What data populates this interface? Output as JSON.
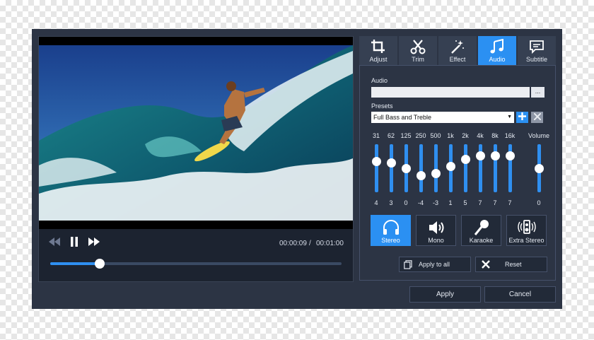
{
  "player": {
    "current_time": "00:00:09",
    "separator": "/",
    "total_time": "00:01:00",
    "progress_fraction": 0.171
  },
  "tabs": [
    {
      "label": "Adjust",
      "icon": "crop-icon",
      "active": false
    },
    {
      "label": "Trim",
      "icon": "scissors-icon",
      "active": false
    },
    {
      "label": "Effect",
      "icon": "magic-wand-icon",
      "active": false
    },
    {
      "label": "Audio",
      "icon": "music-note-icon",
      "active": true
    },
    {
      "label": "Subtitle",
      "icon": "subtitle-icon",
      "active": false
    }
  ],
  "audio": {
    "audio_label": "Audio",
    "audio_value": "",
    "browse_label": "...",
    "presets_label": "Presets",
    "preset_value": "Full Bass and Treble"
  },
  "equalizer": {
    "bands": [
      {
        "freq": "31",
        "gain": "4"
      },
      {
        "freq": "62",
        "gain": "3"
      },
      {
        "freq": "125",
        "gain": "0"
      },
      {
        "freq": "250",
        "gain": "-4"
      },
      {
        "freq": "500",
        "gain": "-3"
      },
      {
        "freq": "1k",
        "gain": "1"
      },
      {
        "freq": "2k",
        "gain": "5"
      },
      {
        "freq": "4k",
        "gain": "7"
      },
      {
        "freq": "8k",
        "gain": "7"
      },
      {
        "freq": "16k",
        "gain": "7"
      }
    ],
    "volume": {
      "label": "Volume",
      "value": "0"
    }
  },
  "modes": [
    {
      "label": "Stereo",
      "icon": "headphones-icon",
      "active": true
    },
    {
      "label": "Mono",
      "icon": "speaker-icon",
      "active": false
    },
    {
      "label": "Karaoke",
      "icon": "microphone-icon",
      "active": false
    },
    {
      "label": "Extra Stereo",
      "icon": "surround-speaker-icon",
      "active": false
    }
  ],
  "actions": {
    "apply_all": "Apply to all",
    "reset": "Reset",
    "apply": "Apply",
    "cancel": "Cancel"
  },
  "colors": {
    "accent": "#2b90f2",
    "window_bg": "#2c3444",
    "panel_bg": "#1e2531"
  }
}
